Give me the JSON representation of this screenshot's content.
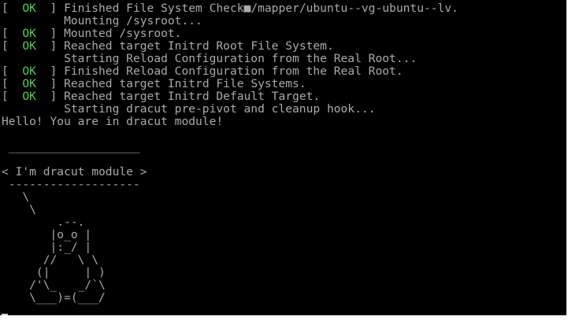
{
  "console": {
    "boot_lines": [
      {
        "status": "OK",
        "text": "Finished File System Check■/mapper/ubuntu--vg-ubuntu--lv."
      },
      {
        "status": "",
        "text": "Mounting /sysroot..."
      },
      {
        "status": "OK",
        "text": "Mounted /sysroot."
      },
      {
        "status": "OK",
        "text": "Reached target Initrd Root File System."
      },
      {
        "status": "",
        "text": "Starting Reload Configuration from the Real Root..."
      },
      {
        "status": "OK",
        "text": "Finished Reload Configuration from the Real Root."
      },
      {
        "status": "OK",
        "text": "Reached target Initrd File Systems."
      },
      {
        "status": "OK",
        "text": "Reached target Initrd Default Target."
      },
      {
        "status": "",
        "text": "Starting dracut pre-pivot and cleanup hook..."
      }
    ],
    "greeting": "Hello! You are in dracut module!",
    "cowsay": [
      "",
      " ___________________",
      "",
      "< I'm dracut module >",
      " -------------------",
      "   \\",
      "    \\",
      "        .--.",
      "       |o_o |",
      "       |:_/ |",
      "      //   \\ \\",
      "     (|     | )",
      "    /'\\_   _/`\\",
      "    \\___)=(___/"
    ]
  },
  "colors": {
    "background": "#000000",
    "text": "#aaaaaa",
    "ok_status": "#55cc55"
  }
}
